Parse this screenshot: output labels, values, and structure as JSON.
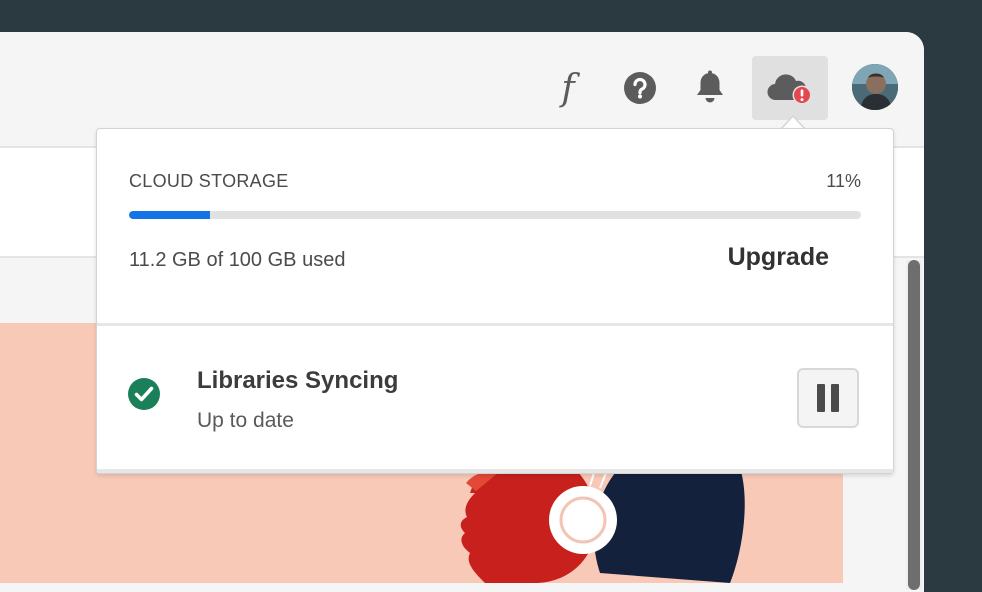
{
  "header": {
    "icons": [
      "font-icon",
      "help-icon",
      "bell-icon",
      "cloud-alert-icon",
      "avatar"
    ],
    "font_glyph": "f"
  },
  "storage": {
    "label": "CLOUD STORAGE",
    "percent_label": "11%",
    "percent": 11,
    "used_text": "11.2 GB of 100 GB used",
    "upgrade_label": "Upgrade"
  },
  "sync": {
    "title": "Libraries Syncing",
    "status": "Up to date",
    "pause_label": "Pause"
  },
  "colors": {
    "accent": "#1473e6",
    "success": "#1b7f5a",
    "alert": "#e34850",
    "hero_bg": "#f9c9b7"
  }
}
